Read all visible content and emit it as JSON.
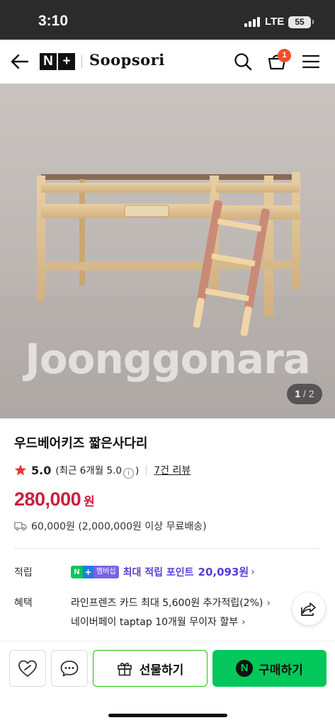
{
  "status_bar": {
    "time": "3:10",
    "network": "LTE",
    "battery": "55"
  },
  "header": {
    "logo_letters": [
      "N",
      "+"
    ],
    "brand": "Soopsori",
    "cart_count": "1",
    "icons": [
      "back-arrow-icon",
      "search-icon",
      "shopping-basket-icon",
      "hamburger-menu-icon"
    ]
  },
  "image": {
    "watermark": "Joonggonara",
    "page_current": "1",
    "page_total": "/ 2"
  },
  "product": {
    "title": "우드베어키즈 짧은사다리",
    "rating_score": "5.0",
    "recent_rating_prefix": "(최근 6개월 5.0",
    "recent_rating_suffix": ")",
    "info_glyph": "i",
    "review_link": "7건 리뷰",
    "price": "280,000",
    "price_unit": "원",
    "shipping": "60,000원 (2,000,000원 이상 무료배송)",
    "price_color": "#cc1f3e"
  },
  "points": {
    "label": "적립",
    "badge_n": "N",
    "badge_plus": "+",
    "badge_text": "멤버십",
    "text": "최대 적립 포인트",
    "amount": "20,093원",
    "chevron": "›"
  },
  "benefits": {
    "label": "혜택",
    "line1": "라인프렌즈 카드 최대 5,600원 추가적립(2%)",
    "line2": "네이버페이 taptap 10개월 무이자 할부",
    "chevron": "›"
  },
  "actions": {
    "gift_label": "선물하기",
    "buy_label": "구매하기",
    "buy_logo": "N",
    "accent_green": "#03c75a"
  }
}
